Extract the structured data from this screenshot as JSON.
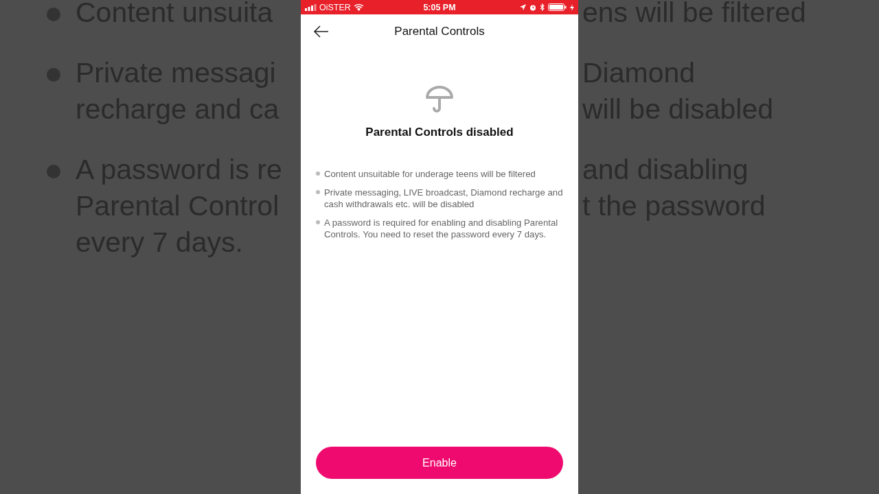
{
  "backdrop": {
    "left_lines": [
      {
        "text": "Content unsuita",
        "bullet": true
      },
      {
        "text": "Private messagi",
        "bullet": true
      },
      {
        "text": "recharge and ca",
        "bullet": false
      },
      {
        "text": "A password is re",
        "bullet": true
      },
      {
        "text": "Parental Control",
        "bullet": false
      },
      {
        "text": "every 7 days.",
        "bullet": false
      }
    ],
    "right_lines": [
      {
        "text": "ens will be filtered"
      },
      {
        "text": "Diamond"
      },
      {
        "text": "will be disabled"
      },
      {
        "text": "and disabling"
      },
      {
        "text": "t the password"
      }
    ]
  },
  "status_bar": {
    "carrier": "OiSTER",
    "time": "5:05 PM"
  },
  "nav": {
    "title": "Parental Controls"
  },
  "status": {
    "heading": "Parental Controls disabled"
  },
  "bullets": [
    "Content unsuitable for underage teens will be filtered",
    "Private messaging, LIVE broadcast, Diamond recharge and cash withdrawals etc. will be disabled",
    "A password is required for enabling and disabling Parental Controls. You need to reset the password every 7 days."
  ],
  "buttons": [
    {
      "label": "Enable",
      "kind": "primary"
    }
  ]
}
